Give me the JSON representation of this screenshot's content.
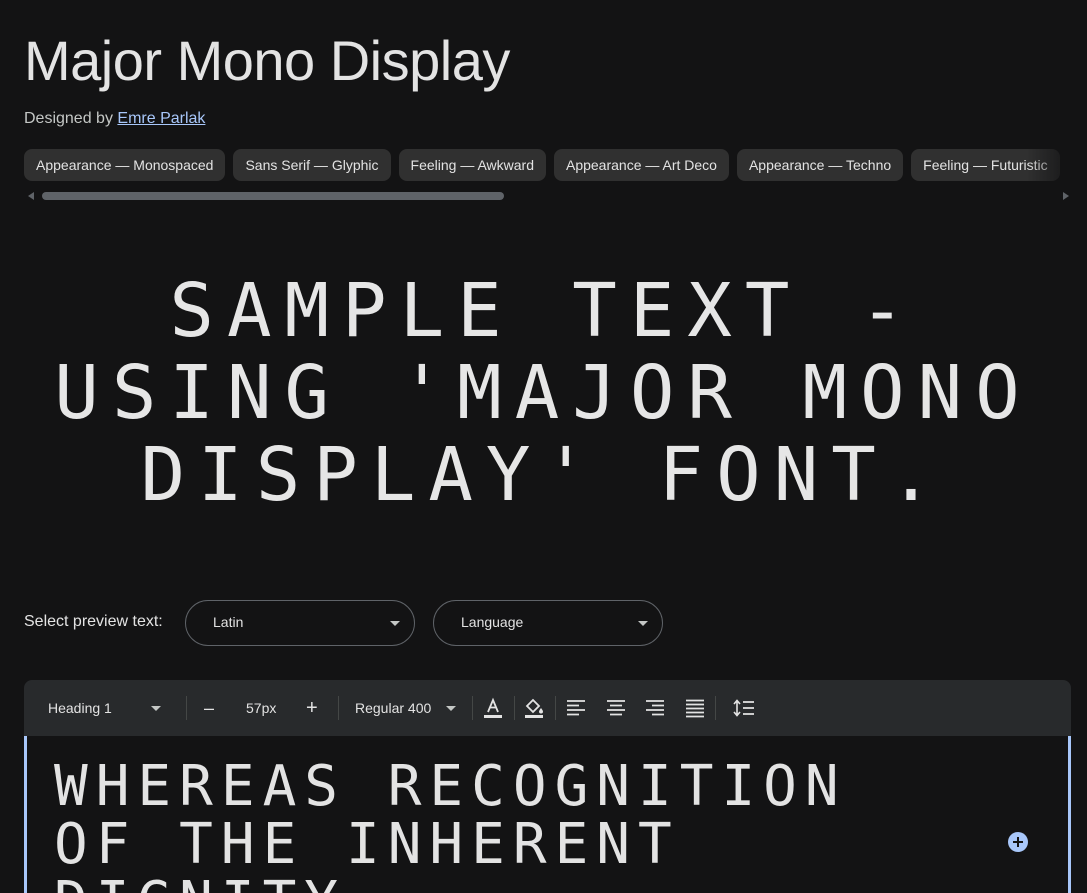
{
  "font": {
    "name": "Major Mono Display",
    "designed_by_prefix": "Designed by",
    "designer": "Emre Parlak"
  },
  "tags": [
    "Appearance — Monospaced",
    "Sans Serif — Glyphic",
    "Feeling — Awkward",
    "Appearance — Art Deco",
    "Appearance — Techno",
    "Feeling — Futuristic"
  ],
  "sample": {
    "line1": "SAMPLE TEXT -",
    "line2": "USING 'MAJOR MONO",
    "line3": "DISPLAY' FONT."
  },
  "preview": {
    "label": "Select preview text:",
    "script_value": "Latin",
    "language_value": "Language"
  },
  "toolbar": {
    "style": "Heading 1",
    "decrease": "–",
    "size": "57px",
    "increase": "+",
    "weight": "Regular 400"
  },
  "editor": {
    "text": "WHEREAS RECOGNITION OF THE INHERENT DIGNITY"
  },
  "colors": {
    "background": "#131314",
    "accent": "#a8c7fa",
    "chip": "#303030",
    "toolbar": "#282a2c"
  }
}
